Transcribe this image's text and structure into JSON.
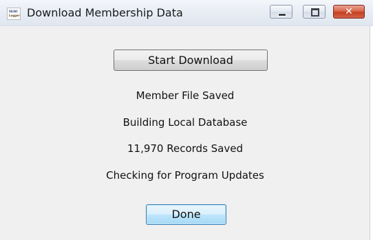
{
  "window": {
    "title": "Download Membership Data",
    "icon": "app-logo-icon",
    "icon_text": [
      "SS/AC",
      "Logger"
    ]
  },
  "controls": {
    "minimize_icon": "minimize-icon",
    "maximize_icon": "maximize-icon",
    "close_icon": "close-icon",
    "close_glyph": "✕"
  },
  "buttons": {
    "start_download": "Start Download",
    "done": "Done"
  },
  "status": {
    "line1": "Member File Saved",
    "line2": "Building Local Database",
    "line3": "11,970 Records Saved",
    "line4": "Checking for Program Updates"
  },
  "colors": {
    "dialog_background": "#f0f0f0",
    "close_button": "#c4411f",
    "default_button_border": "#3c7fb1"
  }
}
